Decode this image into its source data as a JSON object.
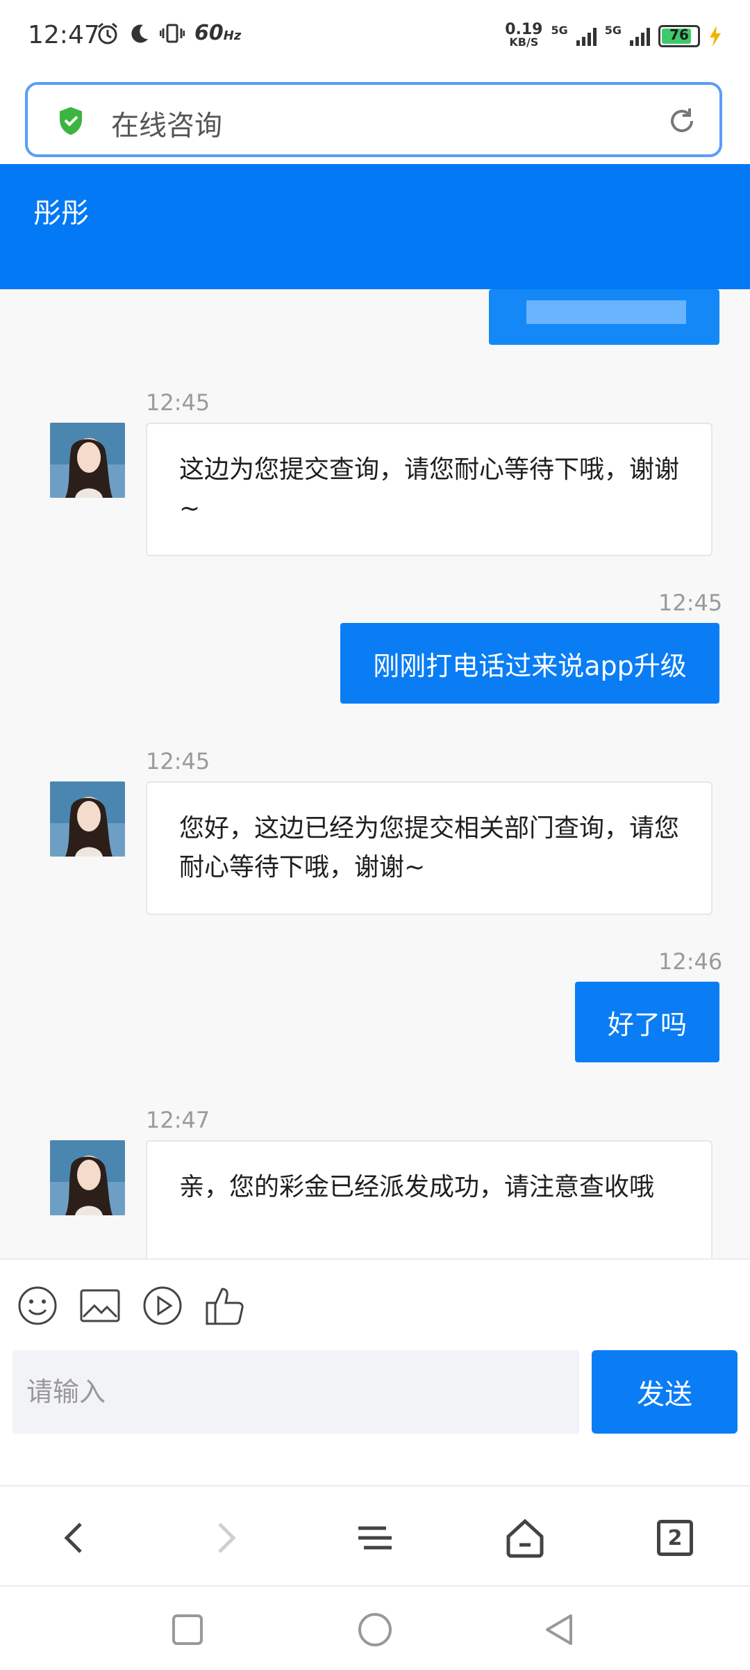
{
  "status_bar": {
    "time": "12:47",
    "refresh": "60",
    "refresh_unit": "Hz",
    "net_speed": "0.19",
    "net_unit": "KB/S",
    "sim1": "5G",
    "sim2": "5G",
    "battery": "76"
  },
  "address_bar": {
    "title": "在线咨询"
  },
  "chat": {
    "agent_name": "彤彤",
    "messages": [
      {
        "side": "left",
        "time": "12:45",
        "text": "这边为您提交查询，请您耐心等待下哦，谢谢~"
      },
      {
        "side": "right",
        "time": "12:45",
        "text": "刚刚打电话过来说app升级"
      },
      {
        "side": "left",
        "time": "12:45",
        "text": "您好，这边已经为您提交相关部门查询，请您耐心等待下哦，谢谢~"
      },
      {
        "side": "right",
        "time": "12:46",
        "text": "好了吗"
      },
      {
        "side": "left",
        "time": "12:47",
        "text": "亲，您的彩金已经派发成功，请注意查收哦"
      }
    ]
  },
  "input": {
    "placeholder": "请输入",
    "send_label": "发送"
  },
  "browser_nav": {
    "tab_count": "2"
  },
  "colors": {
    "accent": "#0a7df5",
    "header": "#0379f5",
    "shield": "#3bb53f"
  }
}
